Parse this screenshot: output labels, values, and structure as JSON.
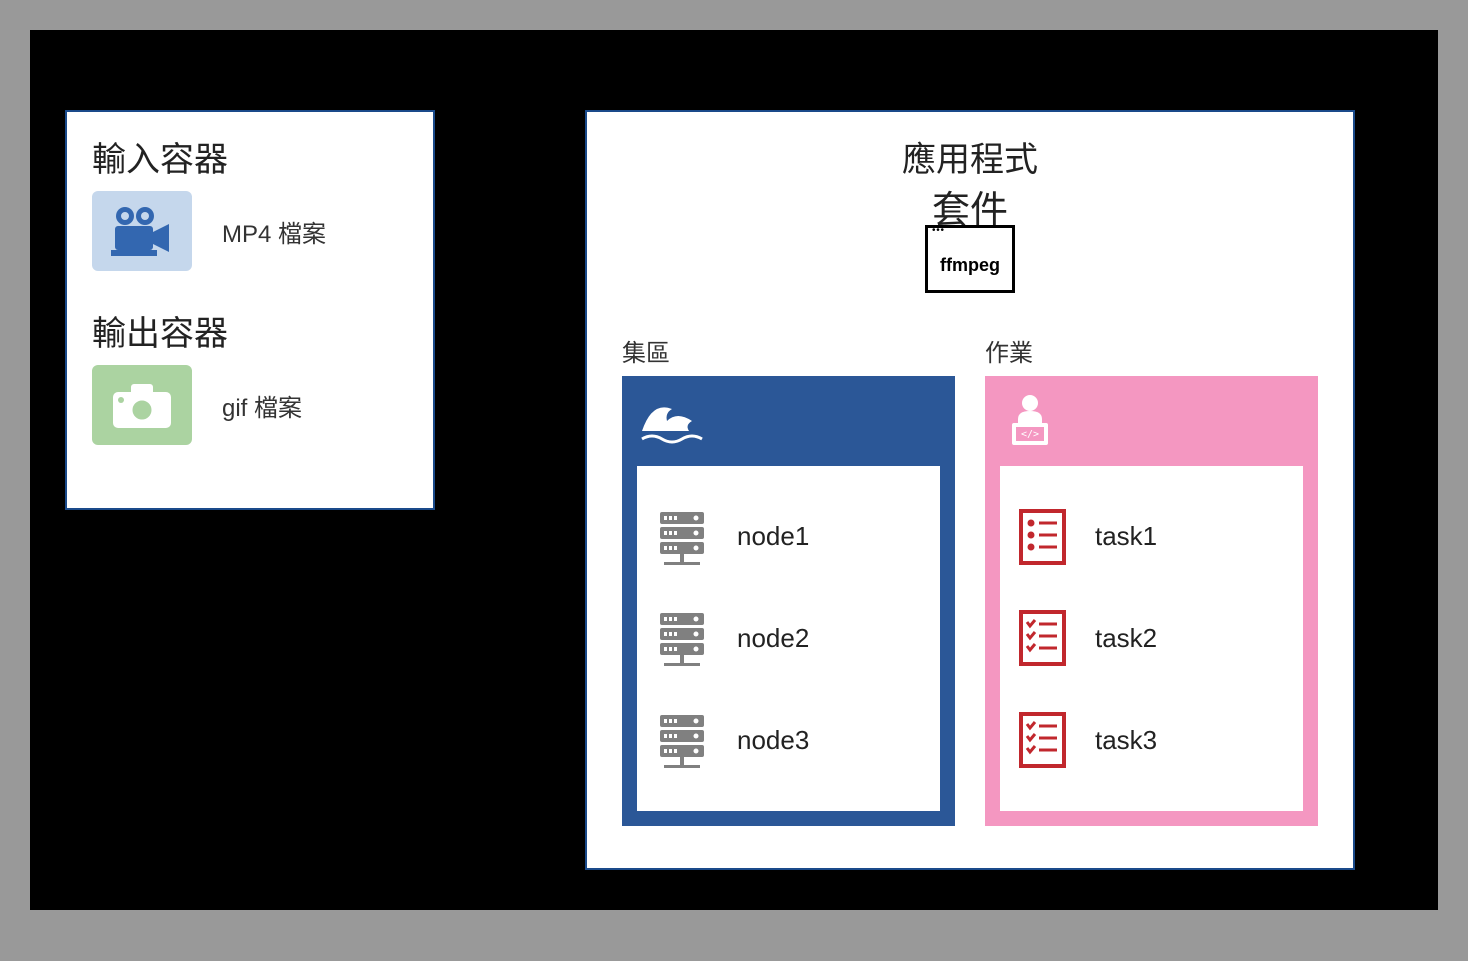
{
  "left": {
    "input_title": "輸入容器",
    "input_file": "MP4 檔案",
    "output_title": "輸出容器",
    "output_file": "gif 檔案"
  },
  "right": {
    "app_title": "應用程式",
    "app_sub": "套件",
    "app_icon_label": "ffmpeg",
    "pool_label": "集區",
    "job_label": "作業",
    "nodes": [
      "node1",
      "node2",
      "node3"
    ],
    "tasks": [
      "task1",
      "task2",
      "task3"
    ]
  },
  "colors": {
    "panel_blue": "#2b5797",
    "panel_pink": "#f497c1",
    "icon_blue": "#3367b0",
    "icon_red": "#c1272d",
    "icon_gray": "#808080"
  }
}
